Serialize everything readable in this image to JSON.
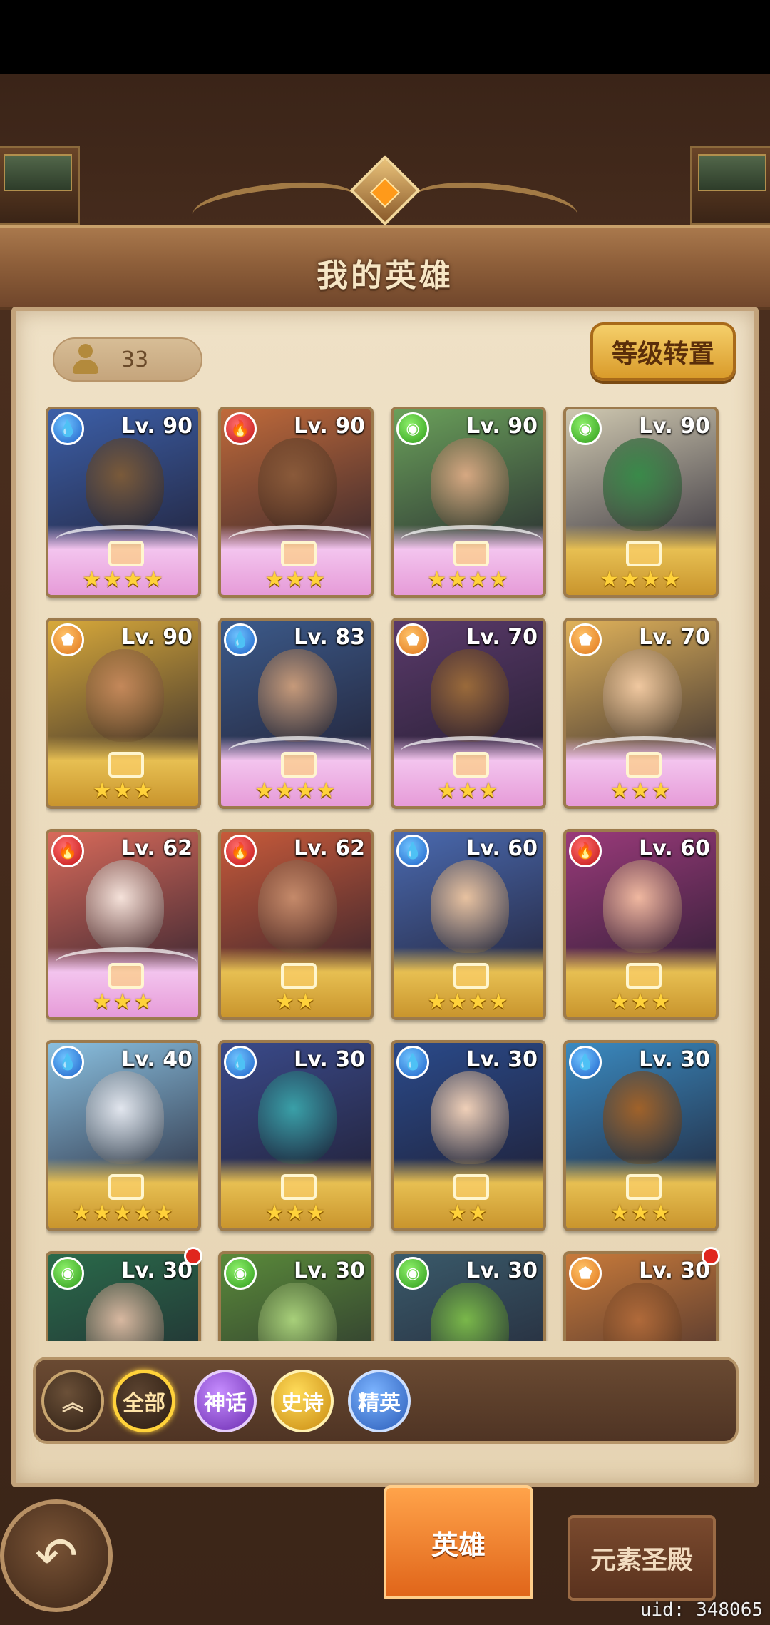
{
  "header": {
    "title": "我的英雄"
  },
  "hero_count": "33",
  "level_reset_button": "等级转置",
  "heroes": [
    {
      "level": "Lv. 90",
      "element": "water",
      "stars": "★★★★",
      "frame": "pink",
      "bg": "#3c5fa8",
      "skin": "#7a5a3a"
    },
    {
      "level": "Lv. 90",
      "element": "fire",
      "stars": "★★★",
      "frame": "pink",
      "bg": "#c06a3a",
      "skin": "#8a5a3a"
    },
    {
      "level": "Lv. 90",
      "element": "wind",
      "stars": "★★★★",
      "frame": "pink",
      "bg": "#6aa05a",
      "skin": "#d6a882"
    },
    {
      "level": "Lv. 90",
      "element": "wind",
      "stars": "★★★★",
      "frame": "gold",
      "bg": "#cfc8b0",
      "skin": "#3a8a4a"
    },
    {
      "level": "Lv. 90",
      "element": "light",
      "stars": "★★★",
      "frame": "gold",
      "bg": "#d8a93a",
      "skin": "#c4885a"
    },
    {
      "level": "Lv. 83",
      "element": "water",
      "stars": "★★★★",
      "frame": "pink",
      "bg": "#3c5a8a",
      "skin": "#c69a7a"
    },
    {
      "level": "Lv. 70",
      "element": "light",
      "stars": "★★★",
      "frame": "pink",
      "bg": "#5a3a6a",
      "skin": "#9a6a3a"
    },
    {
      "level": "Lv. 70",
      "element": "light",
      "stars": "★★★",
      "frame": "pink",
      "bg": "#e0b25a",
      "skin": "#f0c8a0"
    },
    {
      "level": "Lv. 62",
      "element": "fire",
      "stars": "★★★",
      "frame": "pink",
      "bg": "#d86a5a",
      "skin": "#f5e2da"
    },
    {
      "level": "Lv. 62",
      "element": "fire",
      "stars": "★★",
      "frame": "gold",
      "bg": "#c85a3a",
      "skin": "#c58a6a"
    },
    {
      "level": "Lv. 60",
      "element": "water",
      "stars": "★★★★",
      "frame": "gold",
      "bg": "#4a6ab0",
      "skin": "#e8c2a0"
    },
    {
      "level": "Lv. 60",
      "element": "fire",
      "stars": "★★★",
      "frame": "gold",
      "bg": "#9a3a7a",
      "skin": "#f0b8a0"
    },
    {
      "level": "Lv. 40",
      "element": "water",
      "stars": "★★★★★",
      "frame": "gold",
      "bg": "#8ac0e0",
      "skin": "#e2e6ee"
    },
    {
      "level": "Lv. 30",
      "element": "water",
      "stars": "★★★",
      "frame": "gold",
      "bg": "#3a4a8a",
      "skin": "#3aa0a8"
    },
    {
      "level": "Lv. 30",
      "element": "water",
      "stars": "★★",
      "frame": "gold",
      "bg": "#2a4a8a",
      "skin": "#f0d0b8"
    },
    {
      "level": "Lv. 30",
      "element": "water",
      "stars": "★★★",
      "frame": "gold",
      "bg": "#3a8ac0",
      "skin": "#a0622a"
    },
    {
      "level": "Lv. 30",
      "element": "wind",
      "stars": "",
      "frame": "gold",
      "bg": "#2a6a4a",
      "skin": "#d8b8a0"
    },
    {
      "level": "Lv. 30",
      "element": "wind",
      "stars": "",
      "frame": "gold",
      "bg": "#5a8a3a",
      "skin": "#a8d07a"
    },
    {
      "level": "Lv. 30",
      "element": "wind",
      "stars": "",
      "frame": "gold",
      "bg": "#3a5a6a",
      "skin": "#7ab84a"
    },
    {
      "level": "Lv. 30",
      "element": "light",
      "stars": "",
      "frame": "gold",
      "bg": "#c87a3a",
      "skin": "#b06a3a"
    }
  ],
  "filters": {
    "all": "全部",
    "myth": "神话",
    "epic": "史诗",
    "elite": "精英"
  },
  "nav": {
    "heroes_tab": "英雄",
    "elements_tab": "元素圣殿"
  },
  "uid": "uid: 348065"
}
